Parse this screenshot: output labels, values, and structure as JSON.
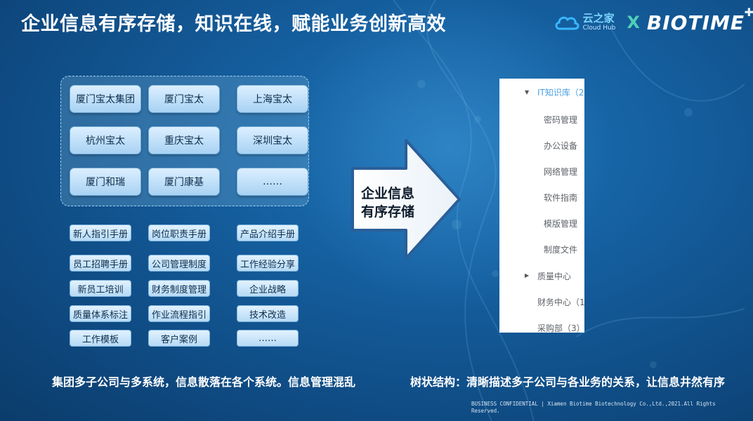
{
  "header": {
    "title": "企业信息有序存储，知识在线，赋能业务创新高效",
    "cloud_hub_cn": "云之家",
    "cloud_hub_en": "Cloud Hub",
    "x_mark": "X",
    "biotime": "BIOTIME"
  },
  "companies": [
    "厦门宝太集团",
    "厦门宝太",
    "上海宝太",
    "杭州宝太",
    "重庆宝太",
    "深圳宝太",
    "厦门和瑞",
    "厦门康基",
    "……"
  ],
  "documents": [
    "新人指引手册",
    "岗位职责手册",
    "产品介绍手册",
    "员工招聘手册",
    "公司管理制度",
    "工作经验分享",
    "新员工培训",
    "财务制度管理",
    "企业战略",
    "质量体系标注",
    "作业流程指引",
    "技术改造",
    "工作模板",
    "客户案例",
    "……"
  ],
  "arrow_label": "企业信息\n有序存储",
  "tree": {
    "root": "IT知识库（2",
    "children": [
      "密码管理",
      "办公设备",
      "网络管理",
      "软件指南",
      "模版管理",
      "制度文件"
    ],
    "quality": "质量中心",
    "finance": "财务中心（1",
    "purchase": "采购部（3）"
  },
  "footer": {
    "left": "集团多子公司与多系统，信息散落在各个系统。信息管理混乱",
    "right": "树状结构：清晰描述多子公司与各业务的关系，让信息井然有序",
    "confidential": "BUSINESS CONFIDENTIAL | Xiamen Biotime Biotechnology Co.,Ltd.,2021.All Rights Reserved."
  },
  "colors": {
    "background": "#155f9f",
    "company_box": "#a8d2f3",
    "tree_root_text": "#4a9fe0"
  }
}
